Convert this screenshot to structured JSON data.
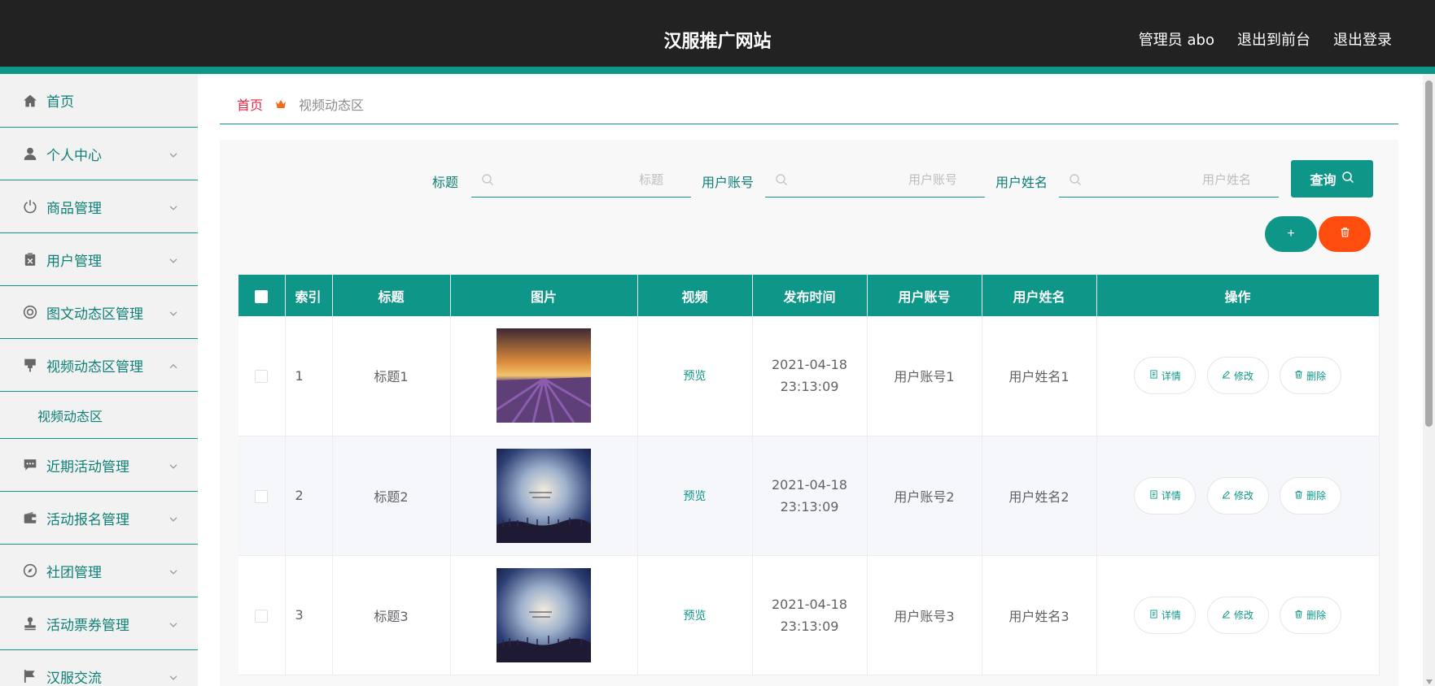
{
  "header": {
    "title": "汉服推广网站",
    "admin": "管理员 abo",
    "back_front": "退出到前台",
    "logout": "退出登录"
  },
  "sidebar": {
    "items": [
      {
        "label": "首页",
        "icon": "home-icon"
      },
      {
        "label": "个人中心",
        "icon": "user-icon"
      },
      {
        "label": "商品管理",
        "icon": "power-icon"
      },
      {
        "label": "用户管理",
        "icon": "clipboard-icon"
      },
      {
        "label": "图文动态区管理",
        "icon": "lifebuoy-icon"
      },
      {
        "label": "视频动态区管理",
        "icon": "pin-icon",
        "expanded": true
      },
      {
        "label": "近期活动管理",
        "icon": "chat-icon"
      },
      {
        "label": "活动报名管理",
        "icon": "wallet-icon"
      },
      {
        "label": "社团管理",
        "icon": "compass-icon"
      },
      {
        "label": "活动票券管理",
        "icon": "stamp-icon"
      },
      {
        "label": "汉服交流",
        "icon": "flag-icon"
      }
    ],
    "submenu": {
      "label": "视频动态区"
    }
  },
  "breadcrumb": {
    "home": "首页",
    "current": "视频动态区"
  },
  "search": {
    "title_label": "标题",
    "title_placeholder": "标题",
    "account_label": "用户账号",
    "account_placeholder": "用户账号",
    "name_label": "用户姓名",
    "name_placeholder": "用户姓名",
    "query_label": "查询"
  },
  "toolbar": {
    "add_label": "+"
  },
  "table": {
    "headers": [
      "索引",
      "标题",
      "图片",
      "视频",
      "发布时间",
      "用户账号",
      "用户姓名",
      "操作"
    ],
    "rows": [
      {
        "index": "1",
        "title": "标题1",
        "video": "预览",
        "time": "2021-04-18 23:13:09",
        "account": "用户账号1",
        "name": "用户姓名1",
        "image": "lavender-field-sunset"
      },
      {
        "index": "2",
        "title": "标题2",
        "video": "预览",
        "time": "2021-04-18 23:13:09",
        "account": "用户账号2",
        "name": "用户姓名2",
        "image": "blue-sky-flowers"
      },
      {
        "index": "3",
        "title": "标题3",
        "video": "预览",
        "time": "2021-04-18 23:13:09",
        "account": "用户账号3",
        "name": "用户姓名3",
        "image": "blue-sky-flowers"
      }
    ],
    "actions": {
      "detail": "详情",
      "edit": "修改",
      "delete": "删除"
    }
  },
  "colors": {
    "accent": "#0e9688",
    "header_bg": "#222222",
    "danger": "#ff4d0f",
    "breadcrumb_home": "#e8264a"
  }
}
